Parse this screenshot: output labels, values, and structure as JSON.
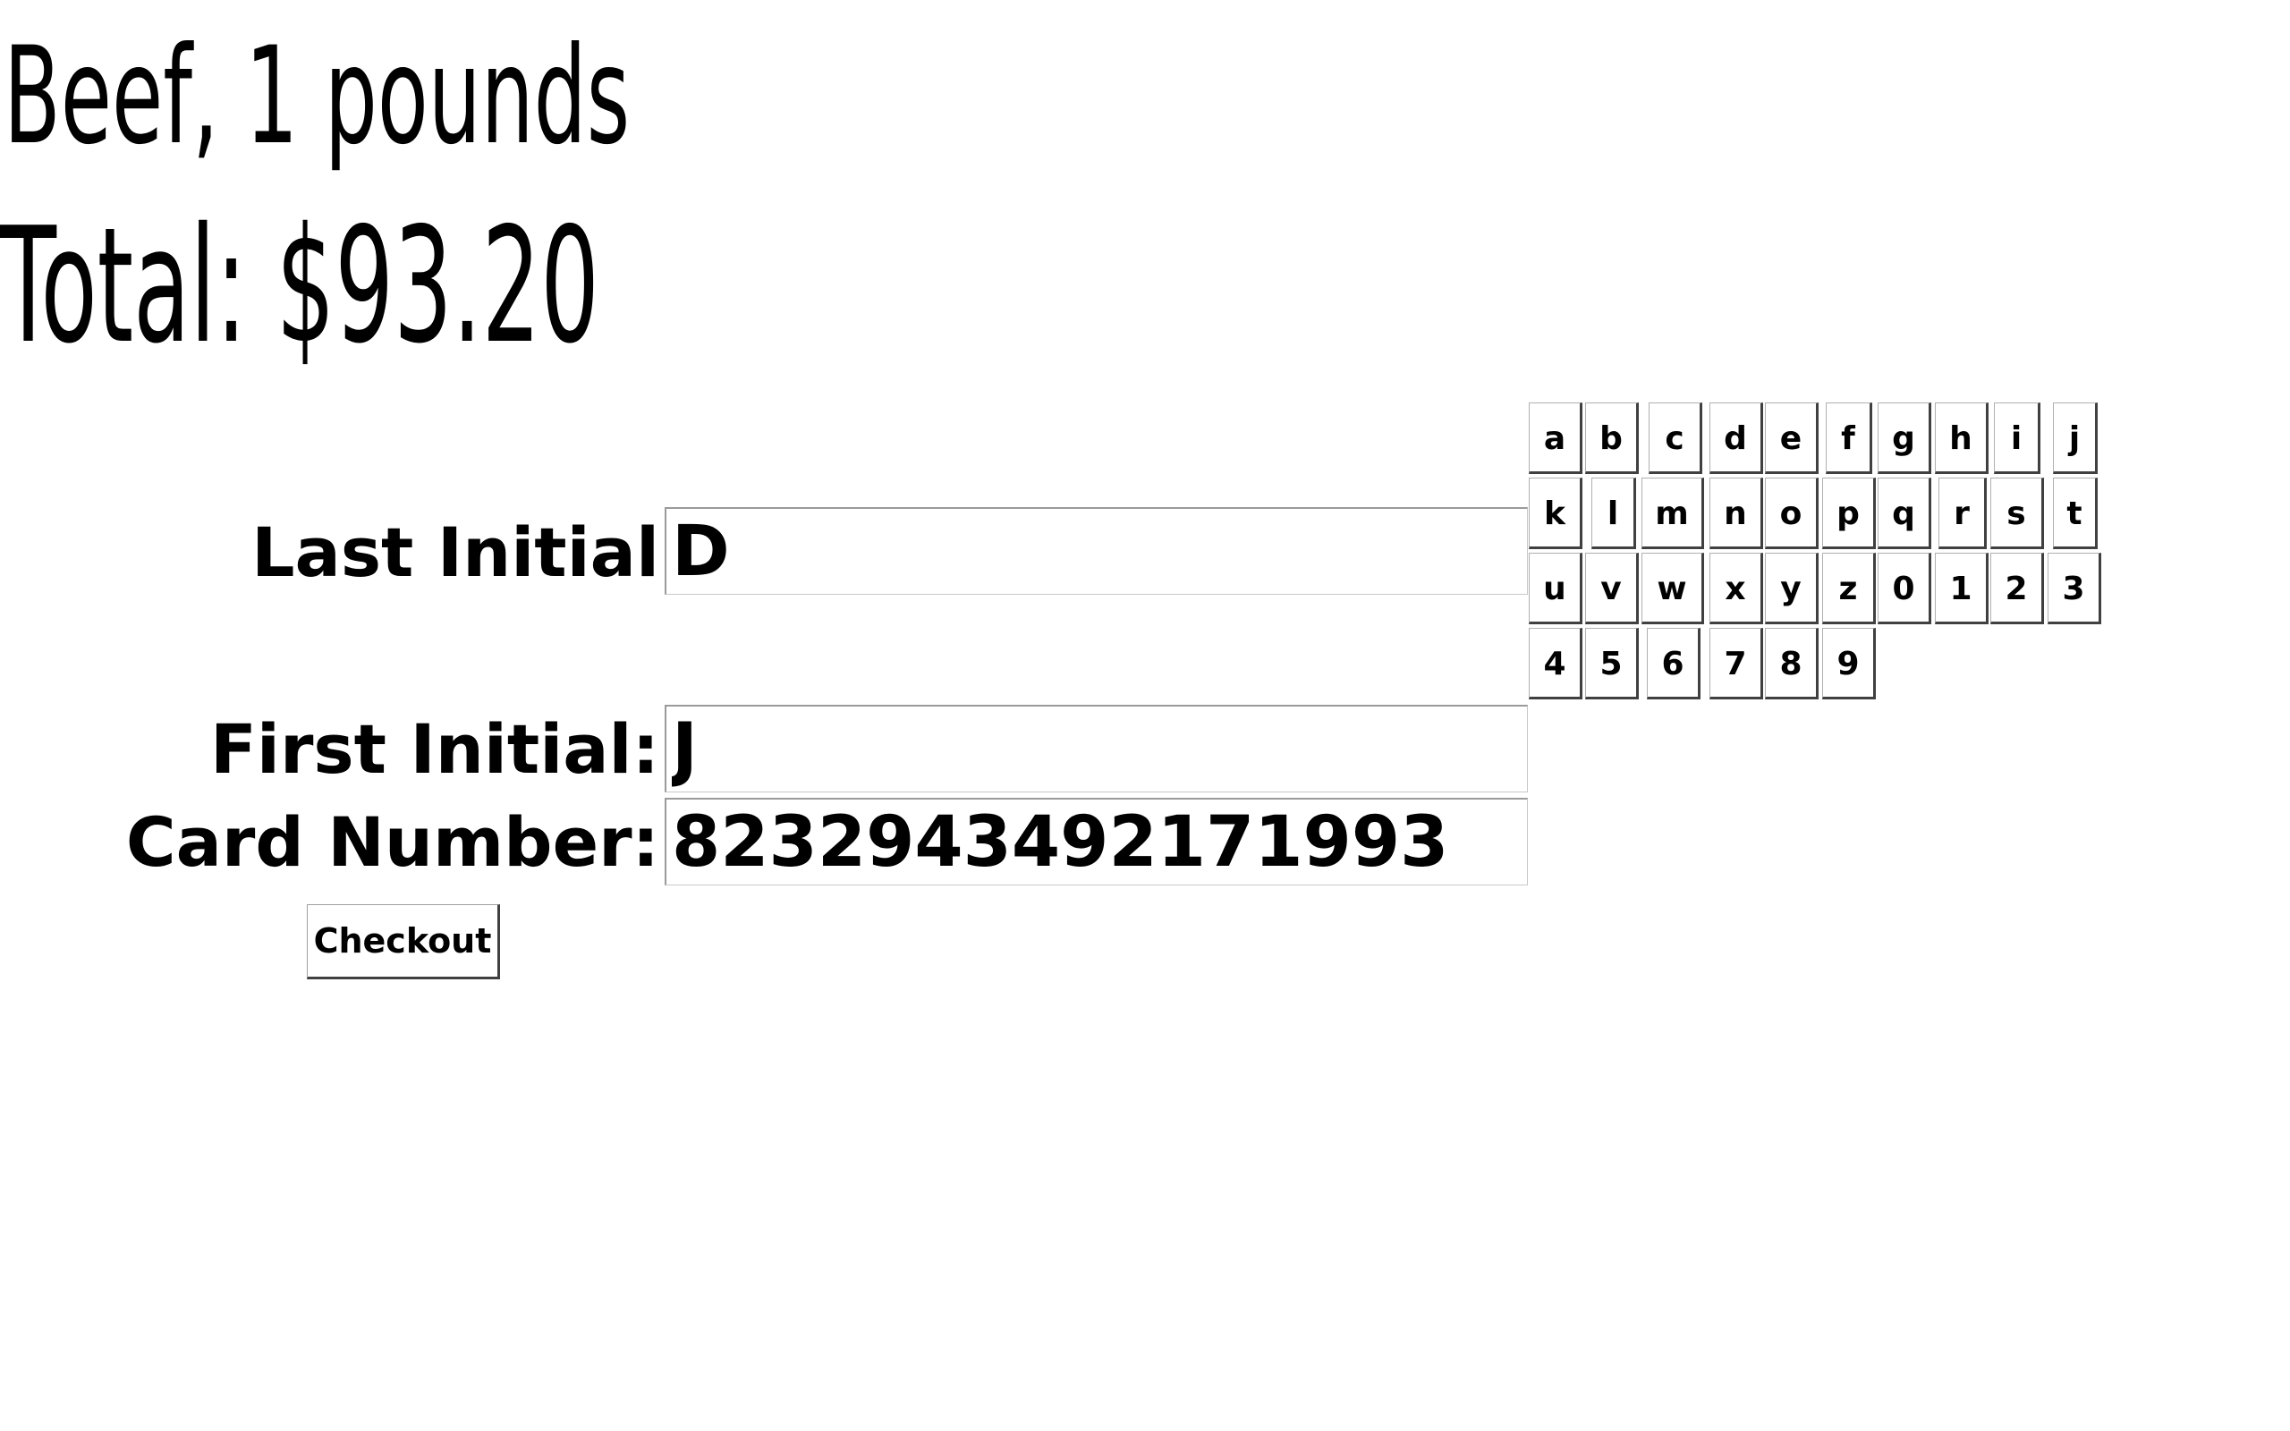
{
  "order": {
    "item_line": "Beef, 1 pounds",
    "total_line": "Total: $93.20"
  },
  "form": {
    "last_initial": {
      "label": "Last Initial",
      "value": "D"
    },
    "first_initial": {
      "label": "First Initial:",
      "value": "J"
    },
    "card_number": {
      "label": "Card Number:",
      "value": "8232943492171993"
    },
    "checkout_label": "Checkout"
  },
  "keyboard": {
    "rows": [
      [
        "a",
        "b",
        "c",
        "d",
        "e",
        "f",
        "g",
        "h",
        "i",
        "j"
      ],
      [
        "k",
        "l",
        "m",
        "n",
        "o",
        "p",
        "q",
        "r",
        "s",
        "t"
      ],
      [
        "u",
        "v",
        "w",
        "x",
        "y",
        "z",
        "0",
        "1",
        "2",
        "3"
      ],
      [
        "4",
        "5",
        "6",
        "7",
        "8",
        "9"
      ]
    ]
  }
}
